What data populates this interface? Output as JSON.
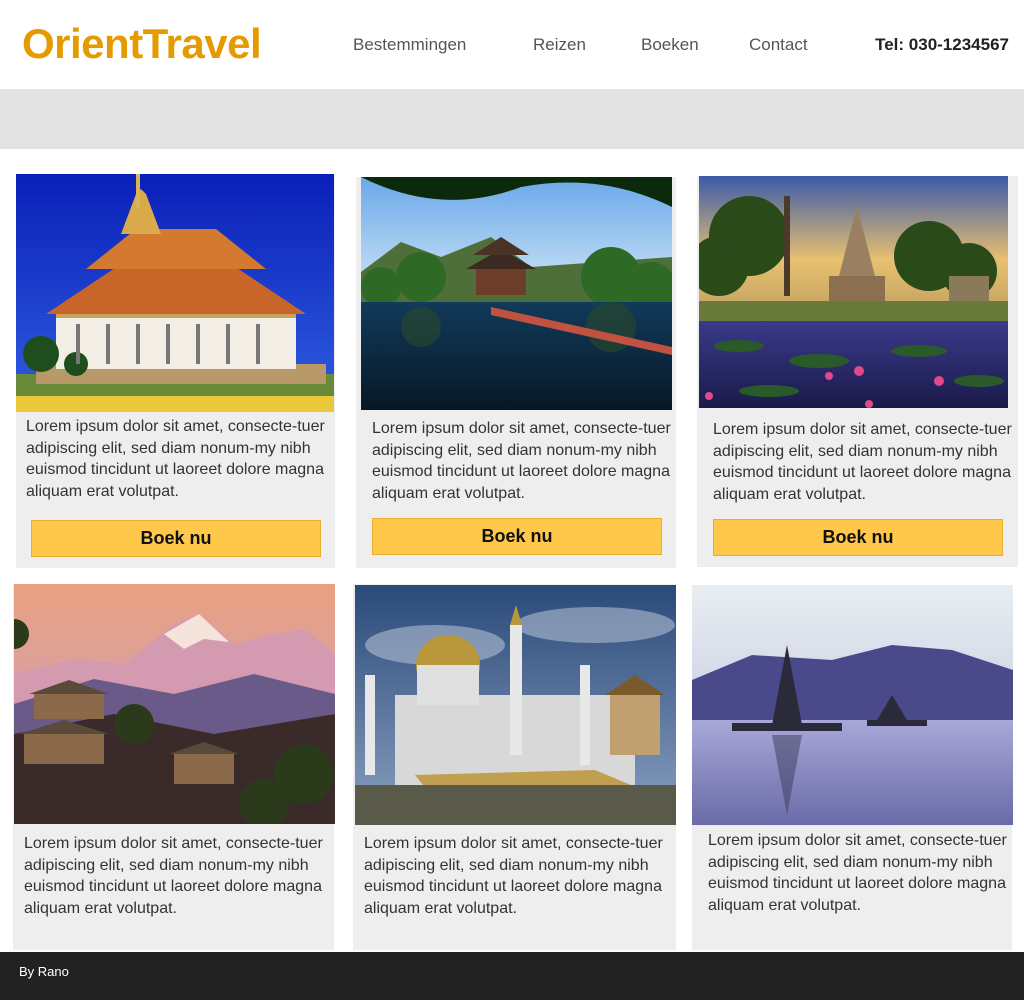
{
  "header": {
    "logo": "OrientTravel",
    "nav": [
      "Bestemmingen",
      "Reizen",
      "Boeken",
      "Contact"
    ],
    "phone": "Tel: 030-1234567"
  },
  "cards": [
    {
      "image": "cambodia-royal-palace-photo",
      "text": "Lorem ipsum dolor sit amet, consecte-tuer adipiscing elit, sed diam nonum-my nibh euismod tincidunt ut laoreet dolore magna aliquam erat volutpat.",
      "button": "Boek nu"
    },
    {
      "image": "korea-pavilion-lake-photo",
      "text": "Lorem ipsum dolor sit amet, consecte-tuer adipiscing elit, sed diam nonum-my nibh euismod tincidunt ut laoreet dolore magna aliquam erat volutpat.",
      "button": "Boek nu"
    },
    {
      "image": "thailand-temple-lotus-photo",
      "text": "Lorem ipsum dolor sit amet, consecte-tuer adipiscing elit, sed diam nonum-my nibh euismod tincidunt ut laoreet dolore magna aliquam erat volutpat.",
      "button": "Boek nu"
    },
    {
      "image": "nepal-mountain-village-photo",
      "text": "Lorem ipsum dolor sit amet, consecte-tuer adipiscing elit, sed diam nonum-my nibh euismod tincidunt ut laoreet dolore magna aliquam erat volutpat."
    },
    {
      "image": "brunei-mosque-photo",
      "text": "Lorem ipsum dolor sit amet, consecte-tuer adipiscing elit, sed diam nonum-my nibh euismod tincidunt ut laoreet dolore magna aliquam erat volutpat."
    },
    {
      "image": "bali-lake-temple-photo",
      "text": "Lorem ipsum dolor sit amet, consecte-tuer adipiscing elit, sed diam nonum-my nibh euismod tincidunt ut laoreet dolore magna aliquam erat volutpat."
    }
  ],
  "footer": {
    "credit": "By Rano"
  },
  "colors": {
    "brand": "#e59a00",
    "button": "#ffc84a",
    "card_bg": "#eeeeee",
    "footer_bg": "#222222"
  }
}
